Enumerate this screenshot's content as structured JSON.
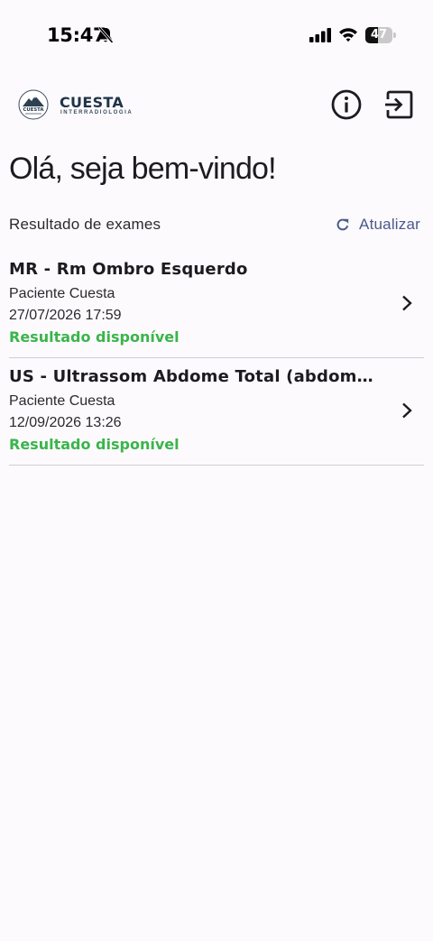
{
  "status_bar": {
    "time": "15:47",
    "battery_level": "47",
    "battery_fraction": 0.47,
    "icons": [
      "bell-slash-icon",
      "signal-icon",
      "wifi-icon",
      "battery-icon"
    ]
  },
  "header": {
    "logo_mark_text": "CUESTA",
    "logo_name": "CUESTA",
    "logo_subtitle": "INTERRADIOLOGIA",
    "info_icon": "info-icon",
    "logout_icon": "logout-icon"
  },
  "welcome": "Olá, seja bem-vindo!",
  "exams_section": {
    "label": "Resultado de exames",
    "refresh_label": "Atualizar",
    "refresh_icon": "refresh-icon"
  },
  "exams": [
    {
      "title": "MR - Rm Ombro Esquerdo",
      "patient": "Paciente Cuesta",
      "date": "27/07/2026 17:59",
      "status": "Resultado disponível"
    },
    {
      "title": "US - Ultrassom Abdome Total (abdome...",
      "patient": "Paciente Cuesta",
      "date": "12/09/2026 13:26",
      "status": "Resultado disponível"
    }
  ],
  "colors": {
    "background": "#fcfafd",
    "status_green": "#3ab54a",
    "accent_blue": "#4b5a8a",
    "brand_navy": "#1f3447",
    "divider": "#cfcfd3"
  }
}
